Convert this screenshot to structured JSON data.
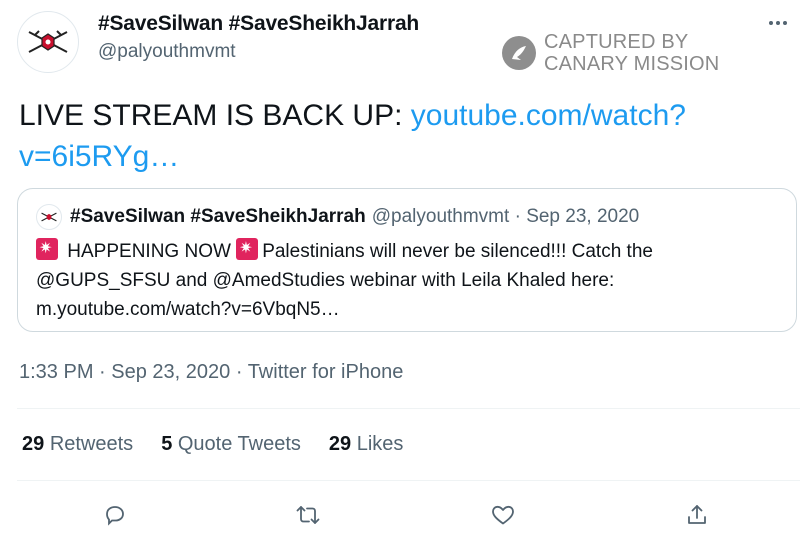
{
  "author": {
    "display_name": "#SaveSilwan #SaveSheikhJarrah",
    "handle": "@palyouthmvmt"
  },
  "watermark": {
    "line1": "CAPTURED BY",
    "line2": "CANARY MISSION"
  },
  "tweet": {
    "text": "LIVE STREAM IS BACK UP: ",
    "link": "youtube.com/watch?v=6i5RYg…"
  },
  "quoted_tweet": {
    "display_name": "#SaveSilwan #SaveSheikhJarrah",
    "handle": "@palyouthmvmt",
    "date": "Sep 23, 2020",
    "text_part1": " HAPPENING NOW ",
    "text_part2": "Palestinians will never be silenced!!! Catch the @GUPS_SFSU and @AmedStudies webinar with Leila Khaled here: m.youtube.com/watch?v=6VbqN5…"
  },
  "meta": {
    "time": "1:33 PM",
    "date": "Sep 23, 2020",
    "source": "Twitter for iPhone"
  },
  "stats": {
    "retweets_count": "29",
    "retweets_label": "Retweets",
    "quotes_count": "5",
    "quotes_label": "Quote Tweets",
    "likes_count": "29",
    "likes_label": "Likes"
  },
  "icons": {
    "reply": "reply-icon",
    "retweet": "retweet-icon",
    "like": "like-icon",
    "share": "share-icon",
    "more": "more-icon"
  }
}
